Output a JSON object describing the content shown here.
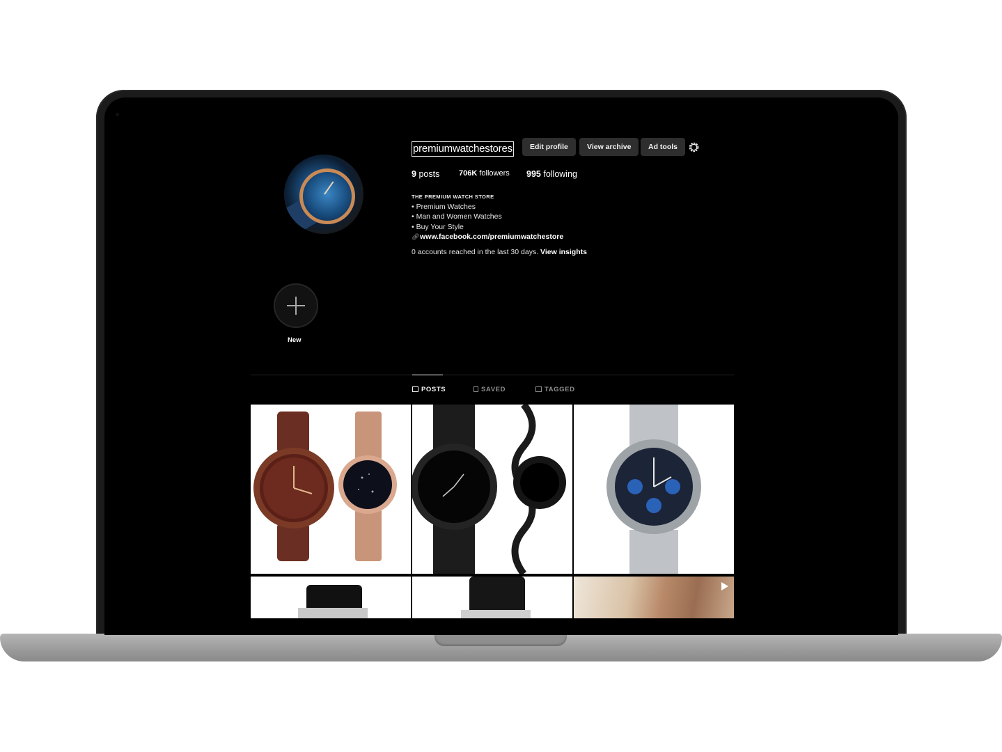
{
  "profile": {
    "username": "premiumwatchestores",
    "buttons": {
      "edit": "Edit profile",
      "archive": "View archive",
      "adtools": "Ad tools"
    },
    "stats": {
      "posts_count": "9",
      "posts_label": "posts",
      "followers_count": "706K",
      "followers_label": "followers",
      "following_count": "995",
      "following_label": "following"
    },
    "bio": {
      "title": "The Premium Watch Store",
      "line1": "• Premium Watches",
      "line2": "• Man and Women Watches",
      "line3": "• Buy Your Style",
      "link": "www.facebook.com/premiumwatchestore"
    },
    "insights": {
      "text": "0 accounts reached in the last 30 days.",
      "link": "View insights"
    }
  },
  "highlights": {
    "new_label": "New"
  },
  "tabs": [
    "POSTS",
    "SAVED",
    "TAGGED"
  ],
  "colors": {
    "background": "#000000",
    "button": "#2e2e2e",
    "text": "#ffffff",
    "muted": "#8e8e8e"
  }
}
